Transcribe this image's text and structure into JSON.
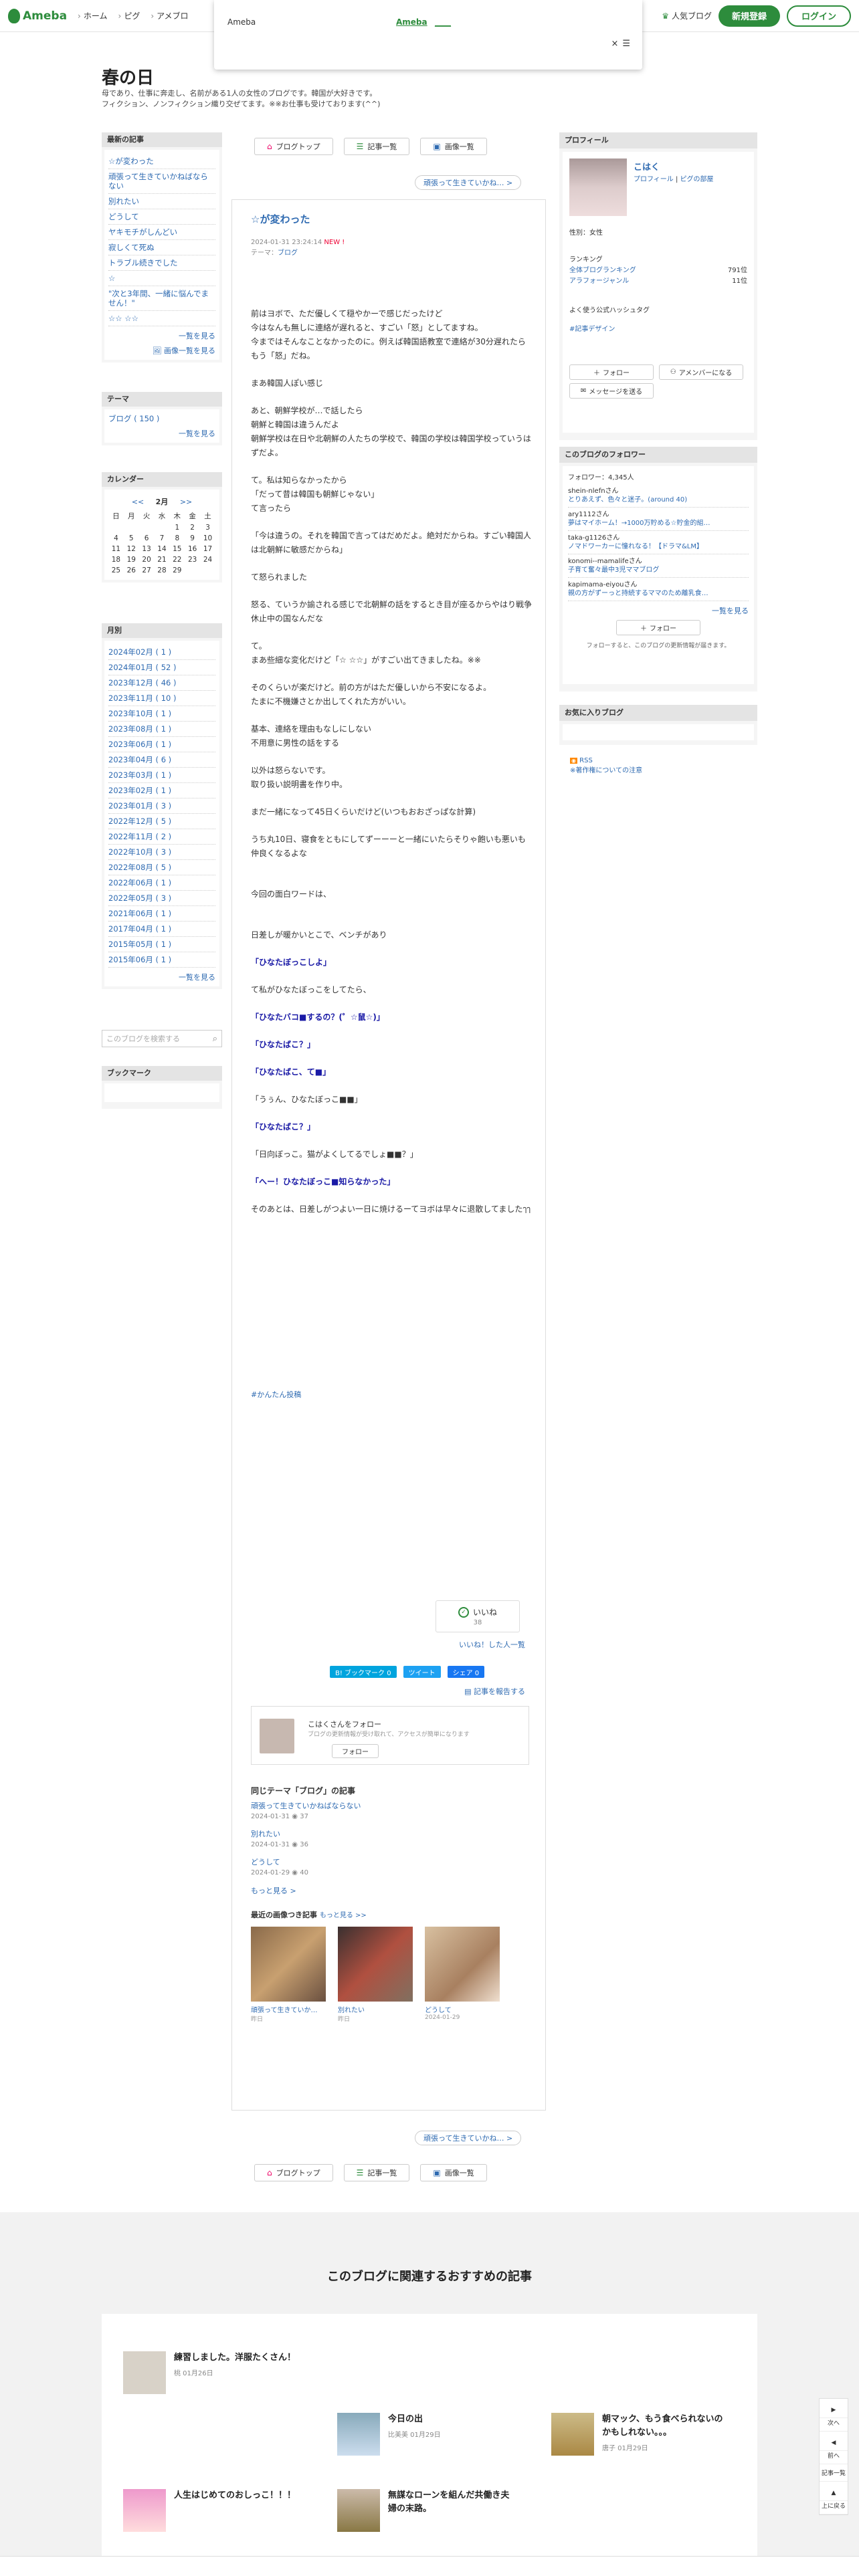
{
  "header": {
    "logo": "Ameba",
    "nav": [
      "ホーム",
      "ピグ",
      "アメブロ"
    ],
    "popular": "人気ブログ",
    "signup": "新規登録",
    "login": "ログイン"
  },
  "ad_popup": {
    "label": "Ameba",
    "link": "Ameba",
    "link2": "____",
    "close": "×"
  },
  "blog": {
    "title": "春の日",
    "description_line1": "母であり、仕事に奔走し、名前がある1人の女性のブログです。韓国が大好きです。",
    "description_line2": "フィクション、ノンフィクション織り交ぜてます。※※お仕事も受けております(^^)"
  },
  "left": {
    "recent_head": "最新の記事",
    "recent_items": [
      "☆が変わった",
      "頑張って生きていかねばならない",
      "別れたい",
      "どうして",
      "ヤキモチがしんどい",
      "寂しくて死ぬ",
      "トラブル続きでした",
      "☆",
      "\"次と3年間、一緒に悩んでません！\"",
      "☆☆ ☆☆"
    ],
    "recent_more": "一覧を見る",
    "recent_more2": "画像一覧を見る",
    "theme_head": "テーマ",
    "theme_item": "ブログ ( 150 )",
    "theme_more": "一覧を見る",
    "calendar_head": "カレンダー",
    "calendar_prev": "<<",
    "calendar_month": "2月",
    "calendar_next": ">>",
    "calendar_days": [
      "日",
      "月",
      "火",
      "水",
      "木",
      "金",
      "土"
    ],
    "calendar_rows": [
      [
        "",
        "",
        "",
        "",
        "1",
        "2",
        "3"
      ],
      [
        "4",
        "5",
        "6",
        "7",
        "8",
        "9",
        "10"
      ],
      [
        "11",
        "12",
        "13",
        "14",
        "15",
        "16",
        "17"
      ],
      [
        "18",
        "19",
        "20",
        "21",
        "22",
        "23",
        "24"
      ],
      [
        "25",
        "26",
        "27",
        "28",
        "29",
        "",
        ""
      ]
    ],
    "archive_head": "月別",
    "archive": [
      "2024年02月 ( 1 )",
      "2024年01月 ( 52 )",
      "2023年12月 ( 46 )",
      "2023年11月 ( 10 )",
      "2023年10月 ( 1 )",
      "2023年08月 ( 1 )",
      "2023年06月 ( 1 )",
      "2023年04月 ( 6 )",
      "2023年03月 ( 1 )",
      "2023年02月 ( 1 )",
      "2023年01月 ( 3 )",
      "2022年12月 ( 5 )",
      "2022年11月 ( 2 )",
      "2022年10月 ( 3 )",
      "2022年08月 ( 5 )",
      "2022年06月 ( 1 )",
      "2022年05月 ( 3 )",
      "2021年06月 ( 1 )",
      "2017年04月 ( 1 )",
      "2015年05月 ( 1 )",
      "2015年06月 ( 1 )"
    ],
    "archive_more": "一覧を見る",
    "search_placeholder": "このブログを検索する",
    "bookmark_head": "ブックマーク"
  },
  "topnav": {
    "top": "ブログトップ",
    "list": "記事一覧",
    "images": "画像一覧",
    "next": "頑張って生きていかね… >"
  },
  "article": {
    "title": "☆が変わった",
    "date": "2024-01-31 23:24:14",
    "new": "NEW !",
    "theme_label": "テーマ：",
    "theme": "ブログ",
    "body": [
      "前はヨボで、ただ優しくて穏やかーで感じだったけど",
      "今はなんも無しに連絡が遅れると、すごい「怒」としてますね。",
      "今まではそんなことなかったのに。例えば韓国語教室で連絡が30分遅れたらもう「怒」だね。",
      "",
      "まあ韓国人ぽい感じ",
      "",
      "あと、朝鮮学校が…で話したら",
      "朝鮮と韓国は違うんだよ",
      "朝鮮学校は在日や北朝鮮の人たちの学校で、韓国の学校は韓国学校っていうはずだよ。",
      "",
      "て。私は知らなかったから",
      "「だって昔は韓国も朝鮮じゃない」",
      "て言ったら",
      "",
      "「今は違うの。それを韓国で言ってはだめだよ。絶対だからね。すごい韓国人は北朝鮮に敏感だからね」",
      "",
      "て怒られました",
      "",
      "怒る、ていうか諭される感じで北朝鮮の話をするとき目が座るからやはり戦争休止中の国なんだな",
      "",
      "て。",
      "まあ些細な変化だけど「☆ ☆☆」がすごい出てきましたね。※※",
      "",
      "そのくらいが楽だけど。前の方がはただ優しいから不安になるよ。",
      "たまに不機嫌さとか出してくれた方がいい。",
      "",
      "基本、連絡を理由もなしにしない",
      "不用意に男性の話をする",
      "",
      "以外は怒らないです。",
      "取り扱い説明書を作り中。",
      "",
      "まだ一緒になって45日くらいだけど(いつもおおざっぱな計算)",
      "",
      "うち丸10日、寝食をともにしてずーーーと一緒にいたらそりゃ飽いも悪いも仲良くなるよな",
      "",
      "",
      "今回の面白ワードは、",
      "",
      "",
      "日差しが暖かいとこで、ベンチがあり",
      "",
      "「ひなたぼっこしよ」",
      "",
      "て私がひなたぼっこをしてたら、",
      "",
      "「ひなたバコ■するの？(゜☆鼠☆)」",
      "",
      "「ひなたばこ？」",
      "",
      "「ひなたばこ、て■」",
      "",
      "「うぅん、ひなたぼっこ■■」",
      "",
      "「ひなたばこ？」",
      "",
      "「日向ぼっこ。猫がよくしてるでしょ■■？」",
      "",
      "「へー！ひなたぼっこ■知らなかった」",
      "",
      "そのあとは、日差しがつよい一日に焼けるーてヨボは早々に退散してましたๅๅ"
    ],
    "hashtag": "#かんたん投稿",
    "iine": "いいね",
    "iine_count": "38",
    "iine_users": "いいね！した人一覧",
    "share_hatena": "B! ブックマーク  0",
    "share_twitter": "ツイート",
    "share_fb": "シェア 0",
    "reblog": "記事を報告する",
    "follow_title": "こはくさんをフォロー",
    "follow_desc": "ブログの更新情報が受け取れて、アクセスが簡単になります",
    "follow_btn": "フォロー",
    "theme_section_label": "同じテーマ「ブログ」の記事",
    "theme_articles": [
      {
        "title": "頑張って生きていかねばならない",
        "date": "2024-01-31",
        "count": "37"
      },
      {
        "title": "別れたい",
        "date": "2024-01-31",
        "count": "36"
      },
      {
        "title": "どうして",
        "date": "2024-01-29",
        "count": "40"
      }
    ],
    "theme_more": "もっと見る >",
    "recent_label": "最近の画像つき記事",
    "recent_more": "もっと見る >>",
    "recent_thumbs": [
      {
        "title": "頑張って生きていか…",
        "date": "昨日"
      },
      {
        "title": "別れたい",
        "date": "昨日"
      },
      {
        "title": "どうして",
        "date": "2024-01-29"
      }
    ]
  },
  "right": {
    "profile_head": "プロフィール",
    "name": "こはく",
    "profile_link": "プロフィール",
    "pigg_link": "ピグの部屋",
    "gender": "性別：女性",
    "ranking_label": "ランキング",
    "rank1_label": "全体ブログランキング",
    "rank1_value": "791位",
    "rank2_label": "アラフォージャンル",
    "rank2_value": "11位",
    "hashtag_label": "よく使う公式ハッシュタグ",
    "hashtag": "#記事デザイン",
    "follow_btn": "フォロー",
    "member_btn": "アメンバーになる",
    "message_btn": "メッセージを送る",
    "followers_head": "このブログのフォロワー",
    "followers_count": "フォロワー：4,345人",
    "followers": [
      {
        "name": "shein-nlefnさん",
        "desc": "とりあえず、色々と迷子。(around 40)"
      },
      {
        "name": "ary1112さん",
        "desc": "夢はマイホーム！→1000万貯める☆貯金的組…"
      },
      {
        "name": "taka-g1126さん",
        "desc": "ノマドワーカーに憧れなる！【ドラマ&LM】"
      },
      {
        "name": "konomi--mamalifeさん",
        "desc": "子育て奮々最中3児ママブログ"
      },
      {
        "name": "kapimama-eiyouさん",
        "desc": "親の方がずーっと持続するママのため離乳食…"
      }
    ],
    "followers_more": "一覧を見る",
    "follow_btn2": "フォロー",
    "follow_note": "フォローすると、このブログの更新情報が届きます。",
    "fav_head": "お気に入りブログ",
    "rss": "RSS",
    "rss_note": "※著作権についての注意"
  },
  "bottom": {
    "title": "このブログに関連するおすすめの記事",
    "recs": [
      {
        "title": "練習しました。洋服たくさん！",
        "meta": "桃 01月26日"
      },
      {
        "title": "今日の出",
        "meta": "比美美 01月29日"
      },
      {
        "title": "朝マック、もう食べられないのかもしれない。。。",
        "meta": "唐子 01月29日"
      },
      {
        "title": "人生はじめてのおしっこ！！！",
        "meta": ""
      },
      {
        "title": "無謀なローンを組んだ共働き夫婦の末路。",
        "meta": ""
      }
    ],
    "float_top": "次へ",
    "float_prev": "前へ",
    "float_list": "記事一覧",
    "float_up": "上に戻る"
  }
}
